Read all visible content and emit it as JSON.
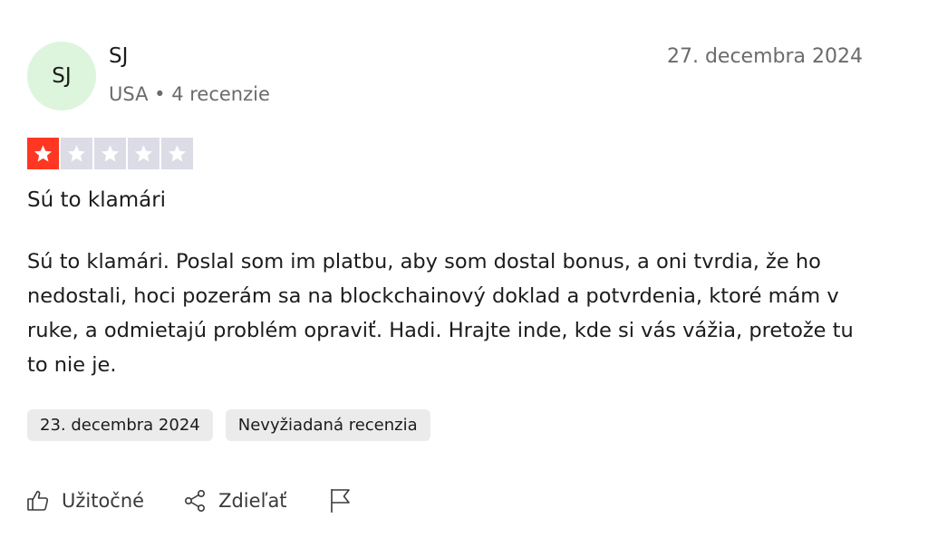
{
  "reviewer": {
    "initials": "SJ",
    "name": "SJ",
    "meta": "USA • 4 recenzie"
  },
  "review": {
    "date": "27. decembra 2024",
    "rating": 1,
    "max_rating": 5,
    "title": "Sú to klamári",
    "body": "Sú to klamári. Poslal som im platbu, aby som dostal bonus, a oni tvrdia, že ho nedostali, hoci pozerám sa na blockchainový doklad a potvrdenia, ktoré mám v ruke, a odmietajú problém opraviť. Hadi. Hrajte inde, kde si vás vážia, pretože tu to nie je."
  },
  "tags": {
    "experience_date": "23. decembra 2024",
    "review_type": "Nevyžiadaná recenzia"
  },
  "actions": {
    "useful_label": "Užitočné",
    "share_label": "Zdieľať",
    "useful_icon": "thumbs-up-icon",
    "share_icon": "share-icon",
    "report_icon": "flag-icon"
  },
  "colors": {
    "star_filled": "#ff3722",
    "star_empty": "#dcdce6",
    "avatar_bg": "#dcf5dc",
    "tag_bg": "#ebebeb"
  }
}
